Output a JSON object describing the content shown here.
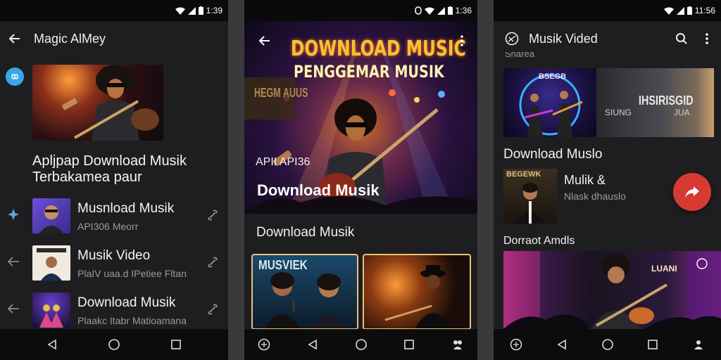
{
  "status": {
    "left_phone_time": "1:39",
    "middle_phone_time": "1:36",
    "right_phone_time": "11:56"
  },
  "screen1": {
    "title": "Magic AlMey",
    "headline_line1": "Apljpap Download Musik",
    "headline_line2": "Terbakamea paur",
    "items": [
      {
        "title": "Musnload Musik",
        "subtitle": "API306 Meorr"
      },
      {
        "title": "Musik Video",
        "subtitle": "PlaIV uaa.d IPetiee Fltan"
      },
      {
        "title": "Download Musik",
        "subtitle": "Plaakc Itabr Matioamana"
      }
    ]
  },
  "screen2": {
    "banner_line1": "DOWNLOAD MUSIC",
    "banner_line2": "PENGGEMAR MUSIK",
    "poster_text": "HEGM AUUS",
    "api_label": "APII API36",
    "hero_title": "Download Musik",
    "section_title": "Download Musik",
    "card1_sign": "MUSVIEK"
  },
  "screen3": {
    "title": "Musik Vided",
    "peek_text": "Sharea",
    "card_left_label": "BSEGB",
    "card_right_title": "IHSIRISGID",
    "card_right_sub1": "SIUNG",
    "card_right_sub2": "JUA",
    "section1_title": "Download Muslo",
    "row_thumb_label": "BEGEWK",
    "row_title": "Mulik &",
    "row_subtitle": "Nlask dhauslo",
    "section2_title": "Dorraot Amdls",
    "banner_sign": "LUANI"
  },
  "colors": {
    "background": "#1e1e20",
    "fab": "#d63a33",
    "accent_blue": "#3aa7e8",
    "banner_yellow": "#f4c430",
    "banner_orange": "#ff6a2b"
  },
  "icons": [
    "back-arrow-icon",
    "more-vert-icon",
    "search-icon",
    "blur-icon",
    "share-icon",
    "wifi-icon",
    "signal-icon",
    "battery-icon",
    "nav-back-icon",
    "nav-home-icon",
    "nav-recents-icon"
  ]
}
